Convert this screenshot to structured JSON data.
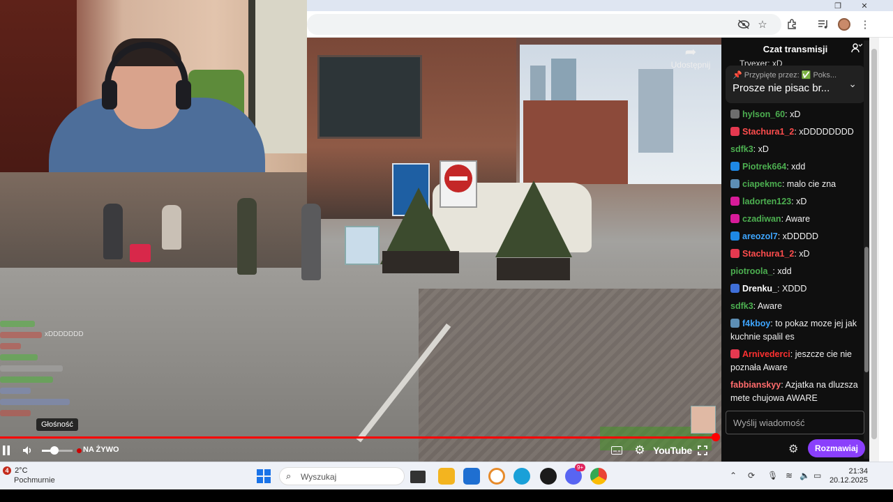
{
  "browser": {
    "toolbar_icons": [
      "eye-off-icon",
      "star-icon",
      "extensions-icon",
      "media-icon",
      "profile-avatar",
      "menu-icon"
    ]
  },
  "video": {
    "share_label": "Udostępnij",
    "volume_tooltip": "Głośność",
    "volume_level": 0.4,
    "progress": 1.0,
    "live_label": "NA ŻYWO",
    "youtube_label": "YouTube",
    "ghost_chat_text": "xDDDDDDD"
  },
  "chat": {
    "title": "Czat transmisji",
    "partial_top": "Trvexer: xD",
    "pinned_meta": "Przypięte przez: ✅ Poks...",
    "pinned_text": "Prosze nie pisac br...",
    "messages": [
      {
        "author": "hylson_60",
        "text": ": xD",
        "color": "#4caf50",
        "badge": "#6d6d6d"
      },
      {
        "author": "Stachura1_2",
        "text": ": xDDDDDDDD",
        "color": "#ff4d4d",
        "badge": "#e53950"
      },
      {
        "author": "sdfk3",
        "text": ": xD",
        "color": "#4caf50",
        "badge": ""
      },
      {
        "author": "Piotrek664",
        "text": ": xdd",
        "color": "#4caf50",
        "badge": "#1e88e5"
      },
      {
        "author": "ciapekmc",
        "text": ": malo cie zna",
        "color": "#4caf50",
        "badge": "#5d8fb5"
      },
      {
        "author": "ladorten123",
        "text": ": xD",
        "color": "#4caf50",
        "badge": "#d81b9a"
      },
      {
        "author": "czadiwan",
        "text": ": Aware",
        "color": "#4caf50",
        "badge": "#d81b9a"
      },
      {
        "author": "areozol7",
        "text": ": xDDDDD",
        "color": "#3ea6ff",
        "badge": "#1e88e5"
      },
      {
        "author": "Stachura1_2",
        "text": ": xD",
        "color": "#ff4d4d",
        "badge": "#e53950"
      },
      {
        "author": "piotroola_",
        "text": ": xdd",
        "color": "#4caf50",
        "badge": ""
      },
      {
        "author": "Drenku_",
        "text": ": XDDD",
        "color": "#ffffff",
        "badge": "#3f6fd8"
      },
      {
        "author": "sdfk3",
        "text": ": Aware",
        "color": "#4caf50",
        "badge": ""
      },
      {
        "author": "f4kboy",
        "text": ": to pokaz moze jej jak kuchnie spalil es",
        "color": "#3ea6ff",
        "badge": "#5d8fb5"
      },
      {
        "author": "Arnivederci",
        "text": ": jeszcze cie nie poznała Aware",
        "color": "#ff3030",
        "badge": "#e53950"
      },
      {
        "author": "fabbianskyy",
        "text": ": Azjatka na dluzsza mete chujowa AWARE",
        "color": "#ff6b6b",
        "badge": ""
      }
    ],
    "input_placeholder": "Wyślij wiadomość",
    "send_label": "Rozmawiaj"
  },
  "taskbar": {
    "alert_count": "4",
    "temperature": "2°C",
    "weather": "Pochmurnie",
    "search_placeholder": "Wyszukaj",
    "time": "21:34",
    "date": "20.12.2025",
    "notification_badge": "9+"
  }
}
